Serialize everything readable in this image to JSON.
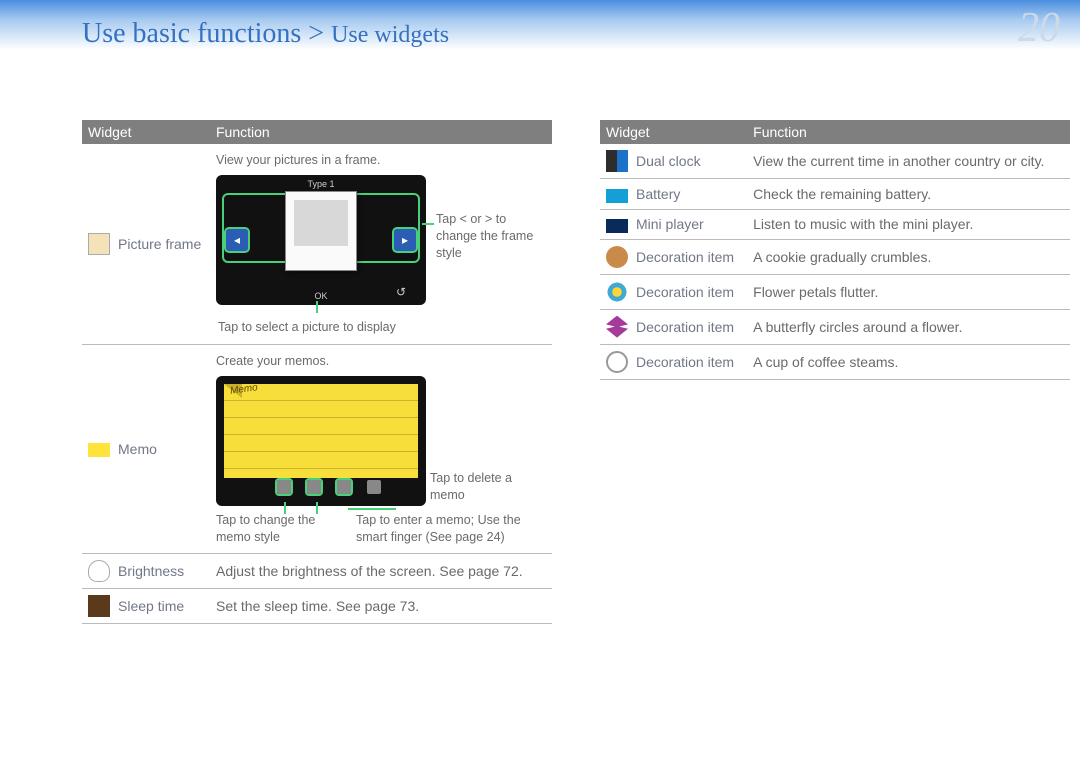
{
  "header": {
    "breadcrumb_main": "Use basic functions",
    "breadcrumb_sep": " > ",
    "breadcrumb_sub": "Use widgets",
    "page_number": "20"
  },
  "table_headers": {
    "widget": "Widget",
    "function": "Function"
  },
  "left_rows": {
    "picture_frame": {
      "name": "Picture frame",
      "desc_top": "View your pictures in a frame.",
      "device_type": "Type 1",
      "ok": "OK",
      "annot_right": "Tap < or > to change the frame style",
      "annot_bottom": "Tap to select a picture to display"
    },
    "memo": {
      "name": "Memo",
      "desc_top": "Create your memos.",
      "memo_label": "Memo",
      "annot_delete": "Tap to delete a memo",
      "annot_style": "Tap to change the memo style",
      "annot_enter": "Tap to enter a memo; Use the smart finger (See page 24)"
    },
    "brightness": {
      "name": "Brightness",
      "desc": "Adjust the brightness of the screen. See page 72."
    },
    "sleep": {
      "name": "Sleep time",
      "desc": "Set the sleep time. See page 73."
    }
  },
  "right_rows": [
    {
      "icon": "dualclock",
      "name": "Dual clock",
      "desc": "View the current time in another country or city."
    },
    {
      "icon": "battery",
      "name": "Battery",
      "desc": "Check the remaining battery."
    },
    {
      "icon": "miniplayer",
      "name": "Mini player",
      "desc": "Listen to music with the mini player."
    },
    {
      "icon": "cookie",
      "name": "Decoration item",
      "desc": "A cookie gradually crumbles."
    },
    {
      "icon": "flower",
      "name": "Decoration item",
      "desc": "Flower petals flutter."
    },
    {
      "icon": "butterfly",
      "name": "Decoration item",
      "desc": "A butterfly circles around a flower."
    },
    {
      "icon": "coffee",
      "name": "Decoration item",
      "desc": "A cup of coffee steams."
    }
  ]
}
